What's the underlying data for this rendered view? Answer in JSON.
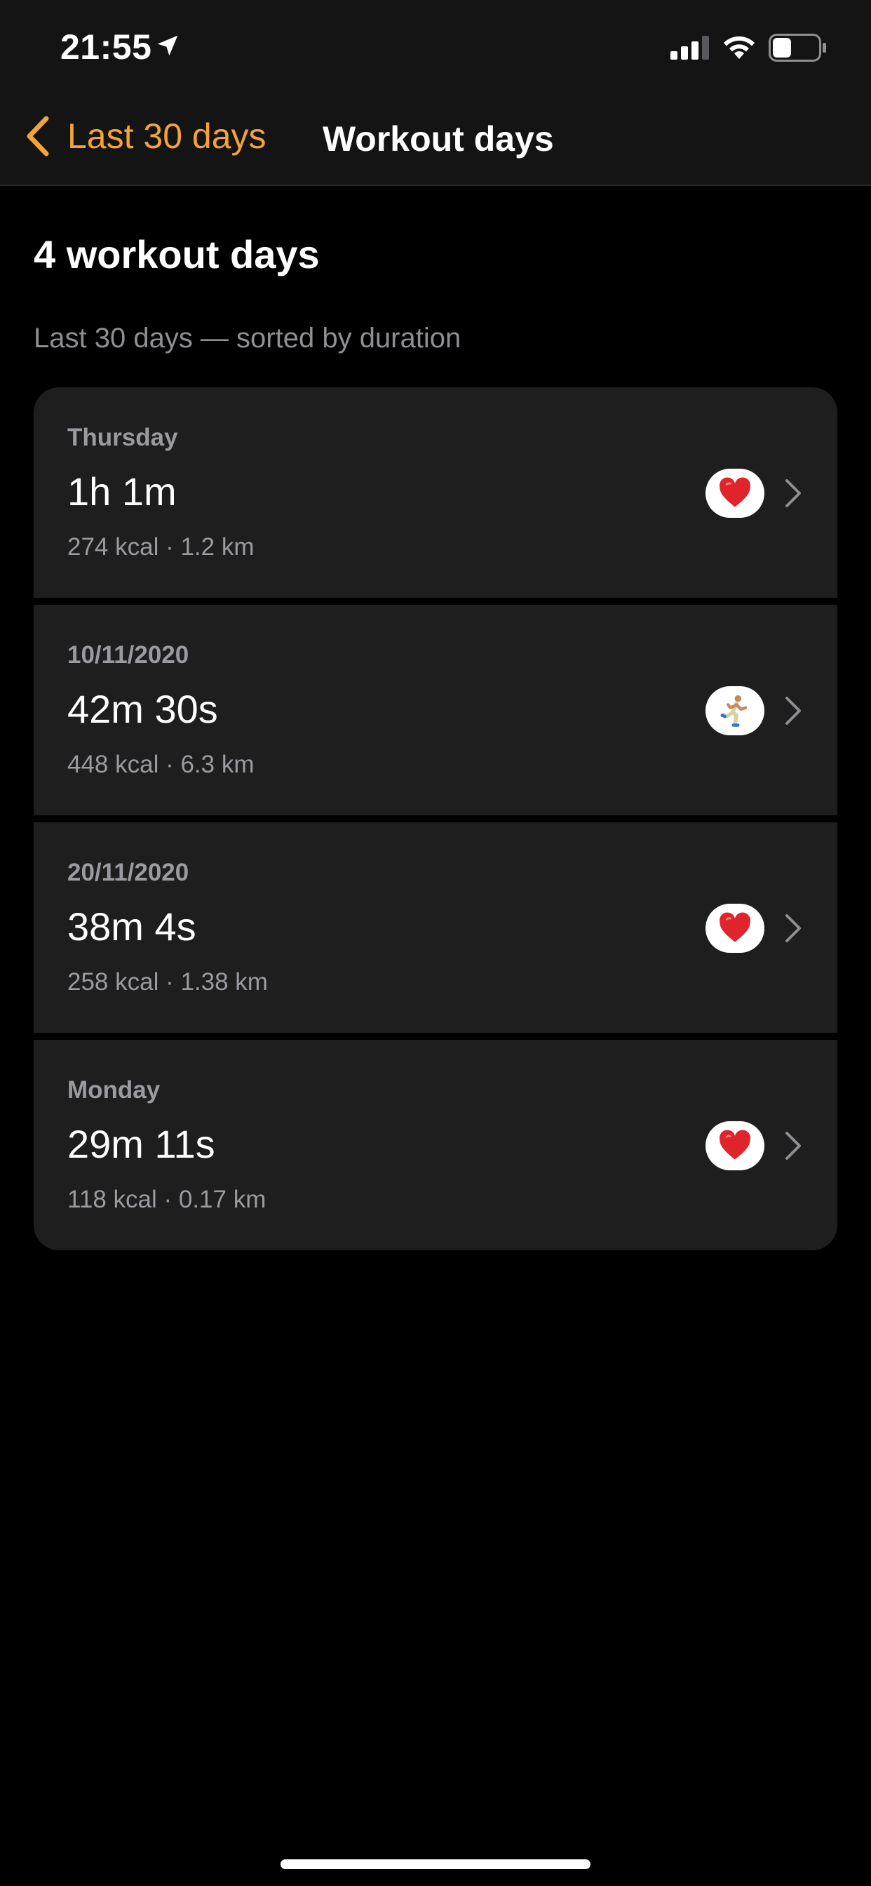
{
  "status_bar": {
    "time": "21:55",
    "location_icon": "location-arrow-icon",
    "signal_icon": "cellular-signal-icon",
    "wifi_icon": "wifi-icon",
    "battery_icon": "battery-icon",
    "battery_level": 0.4
  },
  "nav": {
    "back_label": "Last 30 days",
    "title": "Workout days"
  },
  "header": {
    "title": "4 workout days",
    "subtitle": "Last 30 days — sorted by duration"
  },
  "workouts": [
    {
      "date": "Thursday",
      "duration": "1h 1m",
      "stats": "274 kcal · 1.2 km",
      "icon": "heart-icon"
    },
    {
      "date": "10/11/2020",
      "duration": "42m 30s",
      "stats": "448 kcal · 6.3 km",
      "icon": "runner-icon"
    },
    {
      "date": "20/11/2020",
      "duration": "38m 4s",
      "stats": "258 kcal · 1.38 km",
      "icon": "heart-icon"
    },
    {
      "date": "Monday",
      "duration": "29m 11s",
      "stats": "118 kcal · 0.17 km",
      "icon": "heart-icon"
    }
  ],
  "colors": {
    "accent": "#f2a33a",
    "background": "#000000",
    "card": "#1e1e1e",
    "secondary_text": "#9a9aa0",
    "heart": "#e0242b"
  }
}
